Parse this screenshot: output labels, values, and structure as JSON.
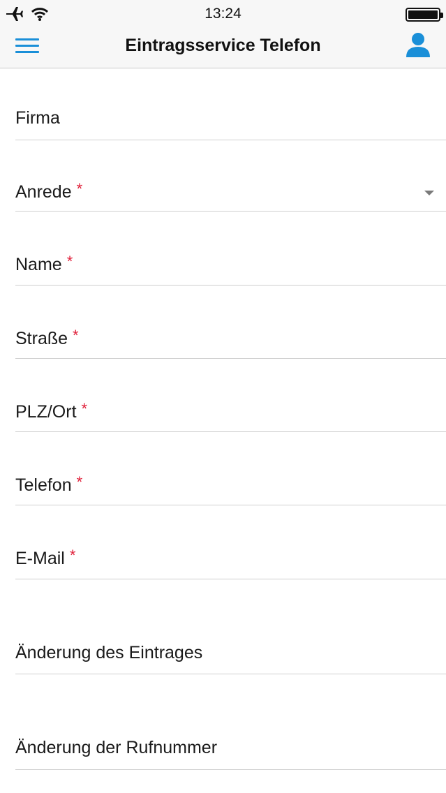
{
  "status_bar": {
    "time": "13:24",
    "icons": [
      "airplane-icon",
      "wifi-icon",
      "battery-icon"
    ]
  },
  "nav": {
    "title": "Eintragsservice Telefon",
    "menu_icon": "hamburger-menu-icon",
    "user_icon": "user-icon",
    "accent_color": "#1a8fd8"
  },
  "form": {
    "required_marker": "*",
    "required_color": "#e0203a",
    "fields": {
      "firma": {
        "label": "Firma",
        "required": false
      },
      "anrede": {
        "label": "Anrede",
        "required": true,
        "type": "select"
      },
      "name": {
        "label": "Name",
        "required": true
      },
      "strasse": {
        "label": "Straße",
        "required": true
      },
      "plz_ort": {
        "label": "PLZ/Ort",
        "required": true
      },
      "telefon": {
        "label": "Telefon",
        "required": true
      },
      "email": {
        "label": "E-Mail",
        "required": true
      },
      "aenderung_eintrag": {
        "label": "Änderung des Eintrages",
        "required": false
      },
      "aenderung_rufnummer": {
        "label": "Änderung der Rufnummer",
        "required": false
      }
    }
  }
}
